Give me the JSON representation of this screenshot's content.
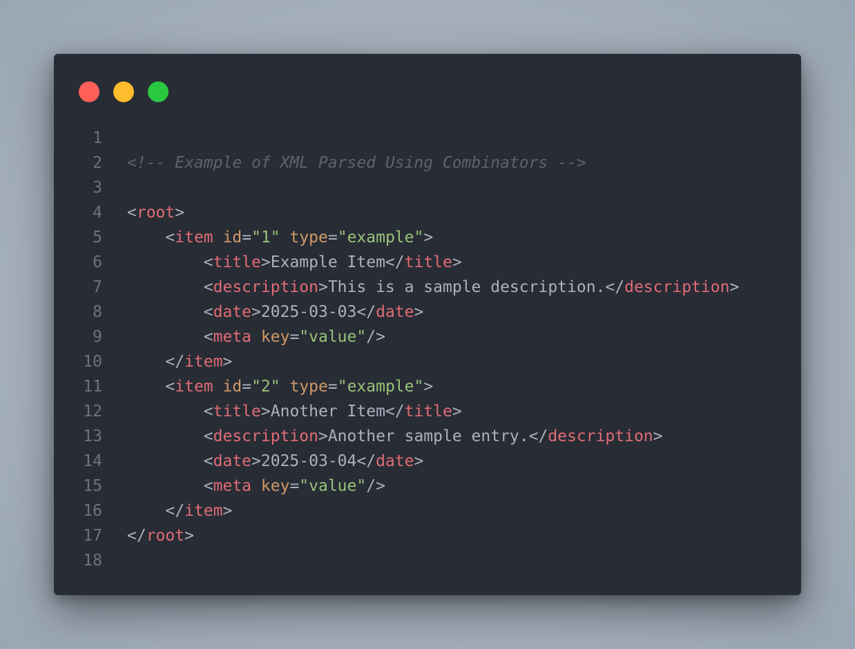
{
  "window": {
    "buttons": [
      {
        "name": "close-button",
        "color": "#ff5f57"
      },
      {
        "name": "minimize-button",
        "color": "#febc2e"
      },
      {
        "name": "zoom-button",
        "color": "#28c840"
      }
    ]
  },
  "code": {
    "language": "xml",
    "lines": [
      {
        "number": "1",
        "tokens": []
      },
      {
        "number": "2",
        "tokens": [
          {
            "t": "comment",
            "v": "<!-- Example of XML Parsed Using Combinators -->"
          }
        ]
      },
      {
        "number": "3",
        "tokens": []
      },
      {
        "number": "4",
        "tokens": [
          {
            "t": "punct",
            "v": "<"
          },
          {
            "t": "tag",
            "v": "root"
          },
          {
            "t": "punct",
            "v": ">"
          }
        ]
      },
      {
        "number": "5",
        "tokens": [
          {
            "t": "ws",
            "v": "    "
          },
          {
            "t": "punct",
            "v": "<"
          },
          {
            "t": "tag",
            "v": "item"
          },
          {
            "t": "ws",
            "v": " "
          },
          {
            "t": "attr",
            "v": "id"
          },
          {
            "t": "punct",
            "v": "="
          },
          {
            "t": "string",
            "v": "\"1\""
          },
          {
            "t": "ws",
            "v": " "
          },
          {
            "t": "attr",
            "v": "type"
          },
          {
            "t": "punct",
            "v": "="
          },
          {
            "t": "string",
            "v": "\"example\""
          },
          {
            "t": "punct",
            "v": ">"
          }
        ]
      },
      {
        "number": "6",
        "tokens": [
          {
            "t": "ws",
            "v": "        "
          },
          {
            "t": "punct",
            "v": "<"
          },
          {
            "t": "tag",
            "v": "title"
          },
          {
            "t": "punct",
            "v": ">"
          },
          {
            "t": "text",
            "v": "Example Item"
          },
          {
            "t": "punct",
            "v": "</"
          },
          {
            "t": "tag",
            "v": "title"
          },
          {
            "t": "punct",
            "v": ">"
          }
        ]
      },
      {
        "number": "7",
        "tokens": [
          {
            "t": "ws",
            "v": "        "
          },
          {
            "t": "punct",
            "v": "<"
          },
          {
            "t": "tag",
            "v": "description"
          },
          {
            "t": "punct",
            "v": ">"
          },
          {
            "t": "text",
            "v": "This is a sample description."
          },
          {
            "t": "punct",
            "v": "</"
          },
          {
            "t": "tag",
            "v": "description"
          },
          {
            "t": "punct",
            "v": ">"
          }
        ]
      },
      {
        "number": "8",
        "tokens": [
          {
            "t": "ws",
            "v": "        "
          },
          {
            "t": "punct",
            "v": "<"
          },
          {
            "t": "tag",
            "v": "date"
          },
          {
            "t": "punct",
            "v": ">"
          },
          {
            "t": "text",
            "v": "2025-03-03"
          },
          {
            "t": "punct",
            "v": "</"
          },
          {
            "t": "tag",
            "v": "date"
          },
          {
            "t": "punct",
            "v": ">"
          }
        ]
      },
      {
        "number": "9",
        "tokens": [
          {
            "t": "ws",
            "v": "        "
          },
          {
            "t": "punct",
            "v": "<"
          },
          {
            "t": "tag",
            "v": "meta"
          },
          {
            "t": "ws",
            "v": " "
          },
          {
            "t": "attr",
            "v": "key"
          },
          {
            "t": "punct",
            "v": "="
          },
          {
            "t": "string",
            "v": "\"value\""
          },
          {
            "t": "punct",
            "v": "/>"
          }
        ]
      },
      {
        "number": "10",
        "tokens": [
          {
            "t": "ws",
            "v": "    "
          },
          {
            "t": "punct",
            "v": "</"
          },
          {
            "t": "tag",
            "v": "item"
          },
          {
            "t": "punct",
            "v": ">"
          }
        ]
      },
      {
        "number": "11",
        "tokens": [
          {
            "t": "ws",
            "v": "    "
          },
          {
            "t": "punct",
            "v": "<"
          },
          {
            "t": "tag",
            "v": "item"
          },
          {
            "t": "ws",
            "v": " "
          },
          {
            "t": "attr",
            "v": "id"
          },
          {
            "t": "punct",
            "v": "="
          },
          {
            "t": "string",
            "v": "\"2\""
          },
          {
            "t": "ws",
            "v": " "
          },
          {
            "t": "attr",
            "v": "type"
          },
          {
            "t": "punct",
            "v": "="
          },
          {
            "t": "string",
            "v": "\"example\""
          },
          {
            "t": "punct",
            "v": ">"
          }
        ]
      },
      {
        "number": "12",
        "tokens": [
          {
            "t": "ws",
            "v": "        "
          },
          {
            "t": "punct",
            "v": "<"
          },
          {
            "t": "tag",
            "v": "title"
          },
          {
            "t": "punct",
            "v": ">"
          },
          {
            "t": "text",
            "v": "Another Item"
          },
          {
            "t": "punct",
            "v": "</"
          },
          {
            "t": "tag",
            "v": "title"
          },
          {
            "t": "punct",
            "v": ">"
          }
        ]
      },
      {
        "number": "13",
        "tokens": [
          {
            "t": "ws",
            "v": "        "
          },
          {
            "t": "punct",
            "v": "<"
          },
          {
            "t": "tag",
            "v": "description"
          },
          {
            "t": "punct",
            "v": ">"
          },
          {
            "t": "text",
            "v": "Another sample entry."
          },
          {
            "t": "punct",
            "v": "</"
          },
          {
            "t": "tag",
            "v": "description"
          },
          {
            "t": "punct",
            "v": ">"
          }
        ]
      },
      {
        "number": "14",
        "tokens": [
          {
            "t": "ws",
            "v": "        "
          },
          {
            "t": "punct",
            "v": "<"
          },
          {
            "t": "tag",
            "v": "date"
          },
          {
            "t": "punct",
            "v": ">"
          },
          {
            "t": "text",
            "v": "2025-03-04"
          },
          {
            "t": "punct",
            "v": "</"
          },
          {
            "t": "tag",
            "v": "date"
          },
          {
            "t": "punct",
            "v": ">"
          }
        ]
      },
      {
        "number": "15",
        "tokens": [
          {
            "t": "ws",
            "v": "        "
          },
          {
            "t": "punct",
            "v": "<"
          },
          {
            "t": "tag",
            "v": "meta"
          },
          {
            "t": "ws",
            "v": " "
          },
          {
            "t": "attr",
            "v": "key"
          },
          {
            "t": "punct",
            "v": "="
          },
          {
            "t": "string",
            "v": "\"value\""
          },
          {
            "t": "punct",
            "v": "/>"
          }
        ]
      },
      {
        "number": "16",
        "tokens": [
          {
            "t": "ws",
            "v": "    "
          },
          {
            "t": "punct",
            "v": "</"
          },
          {
            "t": "tag",
            "v": "item"
          },
          {
            "t": "punct",
            "v": ">"
          }
        ]
      },
      {
        "number": "17",
        "tokens": [
          {
            "t": "punct",
            "v": "</"
          },
          {
            "t": "tag",
            "v": "root"
          },
          {
            "t": "punct",
            "v": ">"
          }
        ]
      },
      {
        "number": "18",
        "tokens": []
      }
    ]
  }
}
